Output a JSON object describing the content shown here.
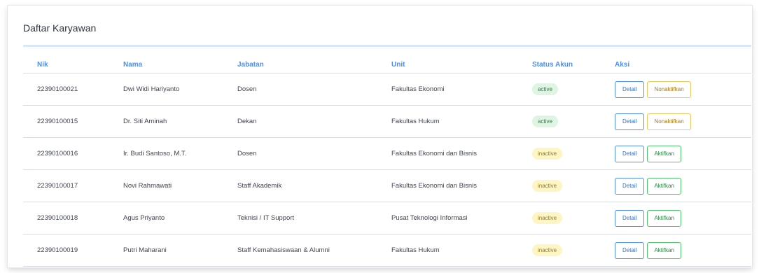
{
  "title": "Daftar Karyawan",
  "columns": [
    "Nik",
    "Nama",
    "Jabatan",
    "Unit",
    "Status Akun",
    "Aksi"
  ],
  "detail_label": "Detail",
  "rows": [
    {
      "nik": "22390100021",
      "nama": "Dwi Widi Hariyanto",
      "jabatan": "Dosen",
      "unit": "Fakultas Ekonomi",
      "status": "active",
      "action": "Nonaktifkan"
    },
    {
      "nik": "22390100015",
      "nama": "Dr. Siti Aminah",
      "jabatan": "Dekan",
      "unit": "Fakultas Hukum",
      "status": "active",
      "action": "Nonaktifkan"
    },
    {
      "nik": "22390100016",
      "nama": "Ir. Budi Santoso, M.T.",
      "jabatan": "Dosen",
      "unit": "Fakultas Ekonomi dan Bisnis",
      "status": "inactive",
      "action": "Aktifkan"
    },
    {
      "nik": "22390100017",
      "nama": "Novi Rahmawati",
      "jabatan": "Staff Akademik",
      "unit": "Fakultas Ekonomi dan Bisnis",
      "status": "inactive",
      "action": "Aktifkan"
    },
    {
      "nik": "22390100018",
      "nama": "Agus Priyanto",
      "jabatan": "Teknisi / IT Support",
      "unit": "Pusat Teknologi Informasi",
      "status": "inactive",
      "action": "Aktifkan"
    },
    {
      "nik": "22390100019",
      "nama": "Putri Maharani",
      "jabatan": "Staff Kemahasiswaan & Alumni",
      "unit": "Fakultas Hukum",
      "status": "inactive",
      "action": "Aktifkan"
    }
  ]
}
